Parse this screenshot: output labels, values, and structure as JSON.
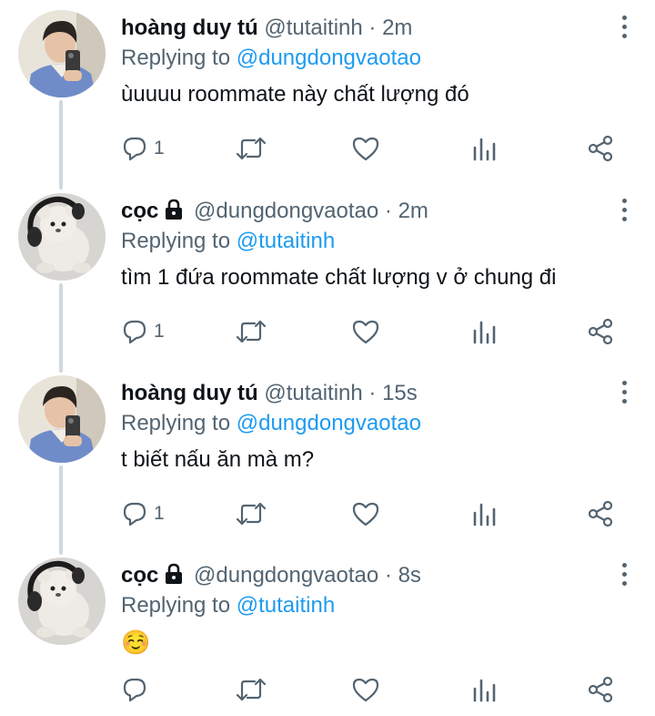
{
  "tweets": [
    {
      "name": "hoàng duy tú",
      "handle": "@tutaitinh",
      "time": "· 2m",
      "locked": false,
      "replying_prefix": "Replying to",
      "replying_to": "@dungdongvaotao",
      "text": "ùuuuu roommate này chất lượng đó",
      "reply_count": "1",
      "avatar": "selfie-avatar"
    },
    {
      "name": "cọc",
      "handle": "@dungdongvaotao",
      "time": "· 2m",
      "locked": true,
      "replying_prefix": "Replying to",
      "replying_to": "@tutaitinh",
      "text": "tìm 1 đứa roommate chất lượng v ở chung đi",
      "reply_count": "1",
      "avatar": "plush-bear-avatar"
    },
    {
      "name": "hoàng duy tú",
      "handle": "@tutaitinh",
      "time": "· 15s",
      "locked": false,
      "replying_prefix": "Replying to",
      "replying_to": "@dungdongvaotao",
      "text": "t biết nấu ăn mà m?",
      "reply_count": "1",
      "avatar": "selfie-avatar"
    },
    {
      "name": "cọc",
      "handle": "@dungdongvaotao",
      "time": "· 8s",
      "locked": true,
      "replying_prefix": "Replying to",
      "replying_to": "@tutaitinh",
      "text": "☺️",
      "reply_count": "",
      "avatar": "plush-bear-avatar"
    }
  ],
  "icons": [
    "reply-icon",
    "retweet-icon",
    "like-icon",
    "analytics-icon",
    "share-icon",
    "more-icon",
    "lock-icon"
  ],
  "colors": {
    "accent": "#1d9bf0",
    "secondary_text": "#536471",
    "thread_line": "#cfd9de"
  }
}
